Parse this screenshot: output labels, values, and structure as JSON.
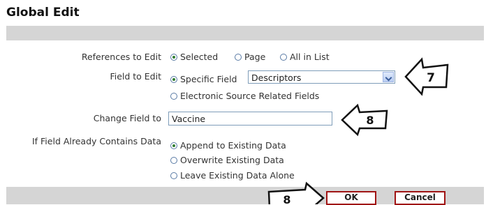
{
  "title": "Global Edit",
  "references": {
    "label": "References to Edit",
    "options": [
      "Selected",
      "Page",
      "All in List"
    ],
    "selected": "Selected"
  },
  "field_to_edit": {
    "label": "Field to Edit",
    "specific_label": "Specific Field",
    "select_value": "Descriptors",
    "electronic_label": "Electronic Source Related Fields",
    "selected": "Specific Field"
  },
  "change_field": {
    "label": "Change Field to",
    "value": "Vaccine"
  },
  "contains_data": {
    "label": "If Field Already Contains Data",
    "options": [
      "Append to Existing Data",
      "Overwrite Existing Data",
      "Leave Existing Data Alone"
    ],
    "selected": "Append to Existing Data"
  },
  "buttons": {
    "ok": "OK",
    "cancel": "Cancel"
  },
  "callouts": {
    "c7": "7",
    "c8a": "8",
    "c8b": "8"
  }
}
